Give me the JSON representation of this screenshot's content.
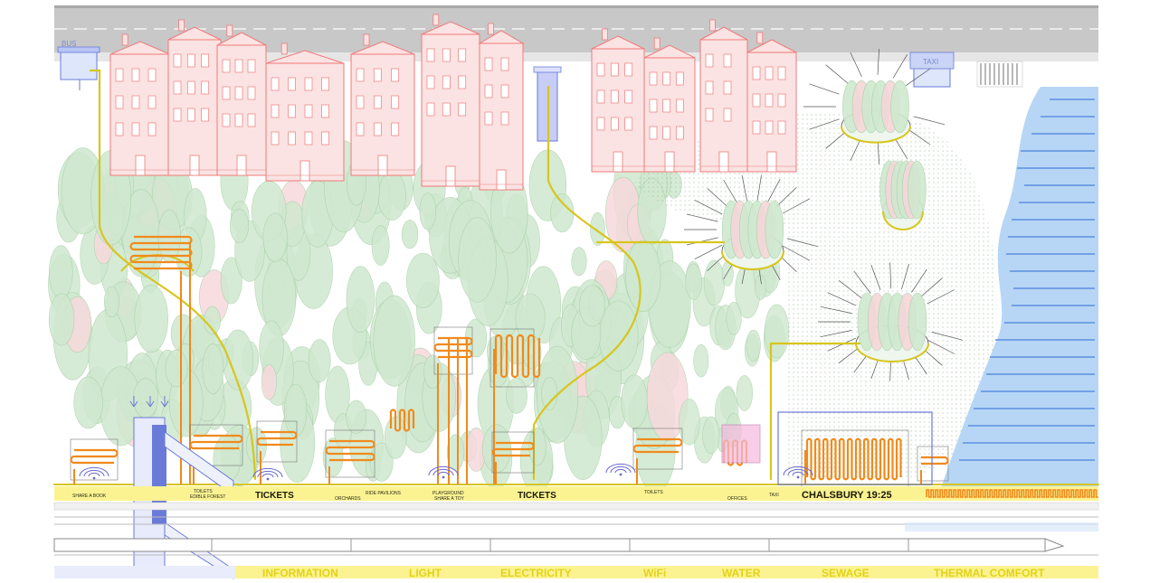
{
  "colors": {
    "road": "#bfbfbf",
    "building": "#f07a7a",
    "buildingFill": "#fbe3e3",
    "tree": "#cfe8cf",
    "treeStroke": "#a9d0a9",
    "pipe": "#d7c61c",
    "coil": "#f08a1c",
    "water": "#9fc8f2",
    "waterLine": "#5b8fe0",
    "band": "#fbf392",
    "bandText": "#e3d21a",
    "station": "#6a7ad8",
    "wifi": "#6a6ad0"
  },
  "signs": {
    "bus": "BUS",
    "taxi": "TAXI"
  },
  "platform_labels": [
    "SHARE A BOOK",
    "EDIBLE FOREST",
    "TOILETS",
    "TICKETS",
    "ORCHARDS",
    "RIDE PAVILIONS",
    "PLAYGROUND",
    "SHARE A TOY",
    "TICKETS",
    "TOILETS",
    "OFFICES",
    "TAXI"
  ],
  "station_display": "CHALSBURY  19:25",
  "services": [
    "INFORMATION",
    "LIGHT",
    "ELECTRICITY",
    "WiFi",
    "WATER",
    "SEWAGE",
    "THERMAL COMFORT"
  ]
}
